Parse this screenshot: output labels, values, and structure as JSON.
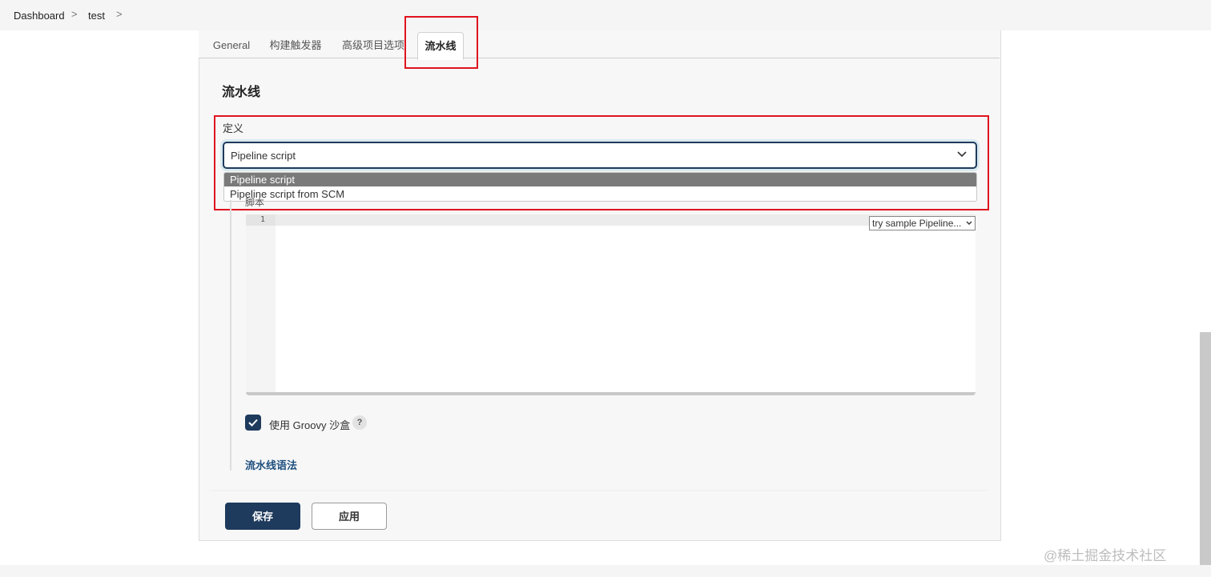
{
  "breadcrumb": {
    "items": [
      "Dashboard",
      "test"
    ],
    "separator": ">"
  },
  "tabs": [
    {
      "label": "General",
      "active": false
    },
    {
      "label": "构建触发器",
      "active": false
    },
    {
      "label": "高级项目选项",
      "active": false
    },
    {
      "label": "流水线",
      "active": true
    }
  ],
  "section": {
    "title": "流水线"
  },
  "definition": {
    "label": "定义",
    "selected": "Pipeline script",
    "options": [
      "Pipeline script",
      "Pipeline script from SCM"
    ]
  },
  "script": {
    "label": "脚本",
    "line_numbers": [
      "1"
    ],
    "sample_select": "try sample Pipeline..."
  },
  "sandbox": {
    "label": "使用 Groovy 沙盒",
    "checked": true,
    "help": "?"
  },
  "syntax_link": "流水线语法",
  "buttons": {
    "save": "保存",
    "apply": "应用"
  },
  "watermark": "@稀土掘金技术社区",
  "colors": {
    "primary": "#1e3a5c",
    "annotation": "#e0131f",
    "link": "#1e4f7e"
  }
}
